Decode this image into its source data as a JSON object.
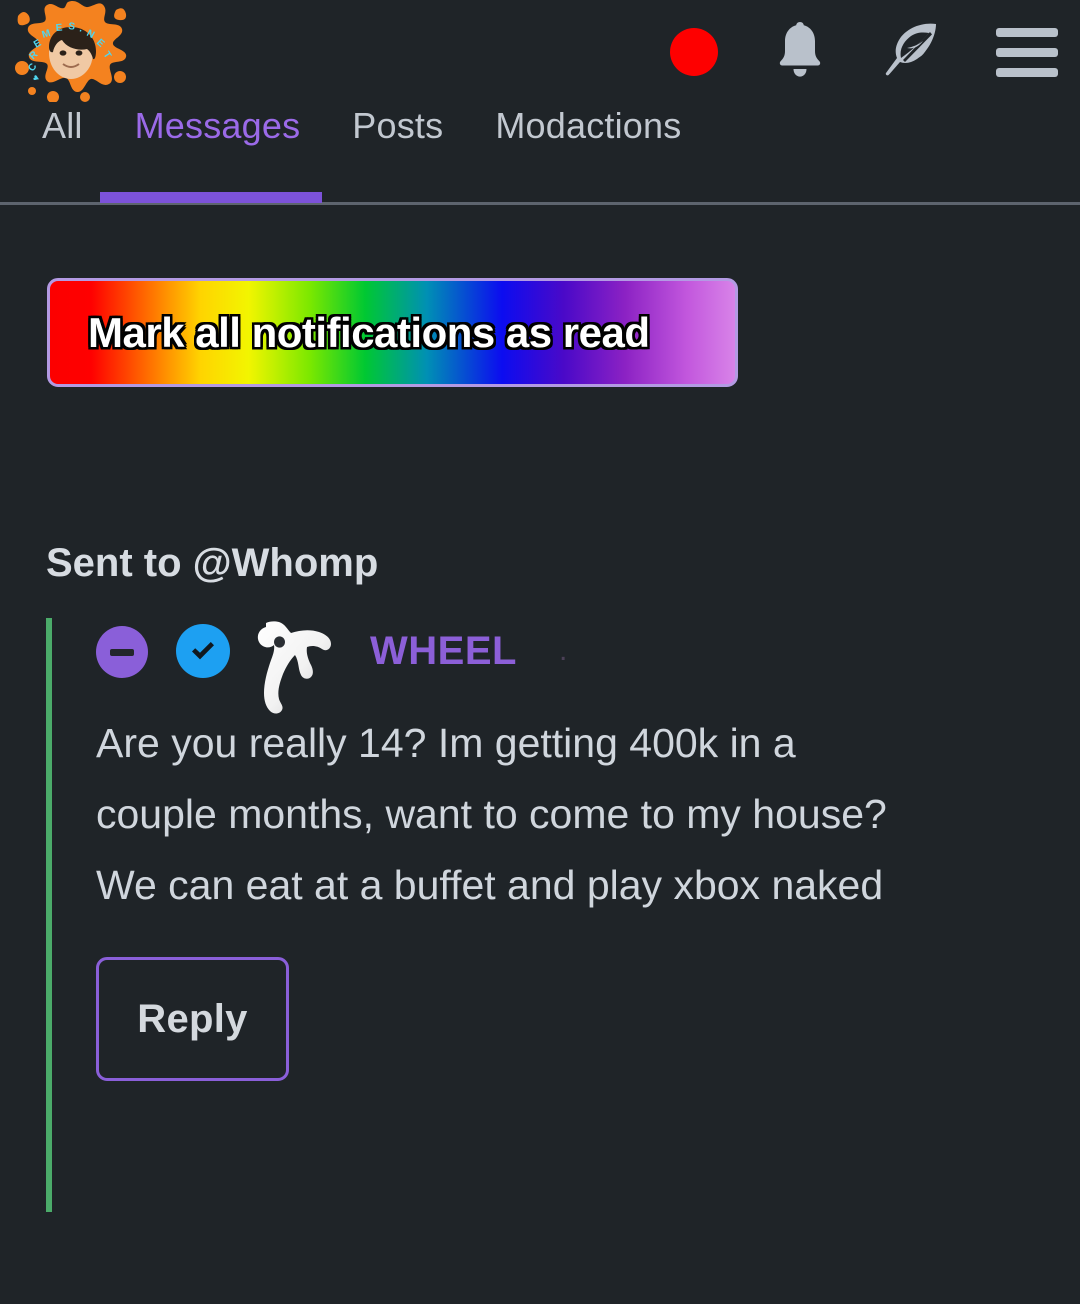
{
  "header": {
    "logo_alt": "cremes.net splat logo",
    "logo_text": "CREMES.NET",
    "icons": [
      {
        "name": "live-indicator-icon",
        "label": "live"
      },
      {
        "name": "bell-icon",
        "label": "notifications"
      },
      {
        "name": "feather-icon",
        "label": "compose"
      },
      {
        "name": "hamburger-menu-icon",
        "label": "menu"
      }
    ]
  },
  "tabs": [
    {
      "label": "All",
      "active": false
    },
    {
      "label": "Messages",
      "active": true
    },
    {
      "label": "Posts",
      "active": false
    },
    {
      "label": "Modactions",
      "active": false
    }
  ],
  "actions": {
    "mark_all_read_label": "Mark all notifications as read"
  },
  "notification": {
    "heading": "Sent to @Whomp",
    "author": "WHEEL",
    "separator": ".",
    "badges": {
      "collapse": "−",
      "verified": "verified-check"
    },
    "message": "Are you really 14? Im getting 400k in a couple months, want to come to my house? We can eat at a buffet and play xbox naked",
    "reply_label": "Reply"
  },
  "colors": {
    "background": "#1f2428",
    "accent_purple": "#8a5fd9",
    "active_tab": "#9b6ae8",
    "thread_line_green": "#4bab6a",
    "verified_blue": "#1da0f2",
    "live_red": "#fe0000",
    "text_primary": "#d0d6dd"
  }
}
